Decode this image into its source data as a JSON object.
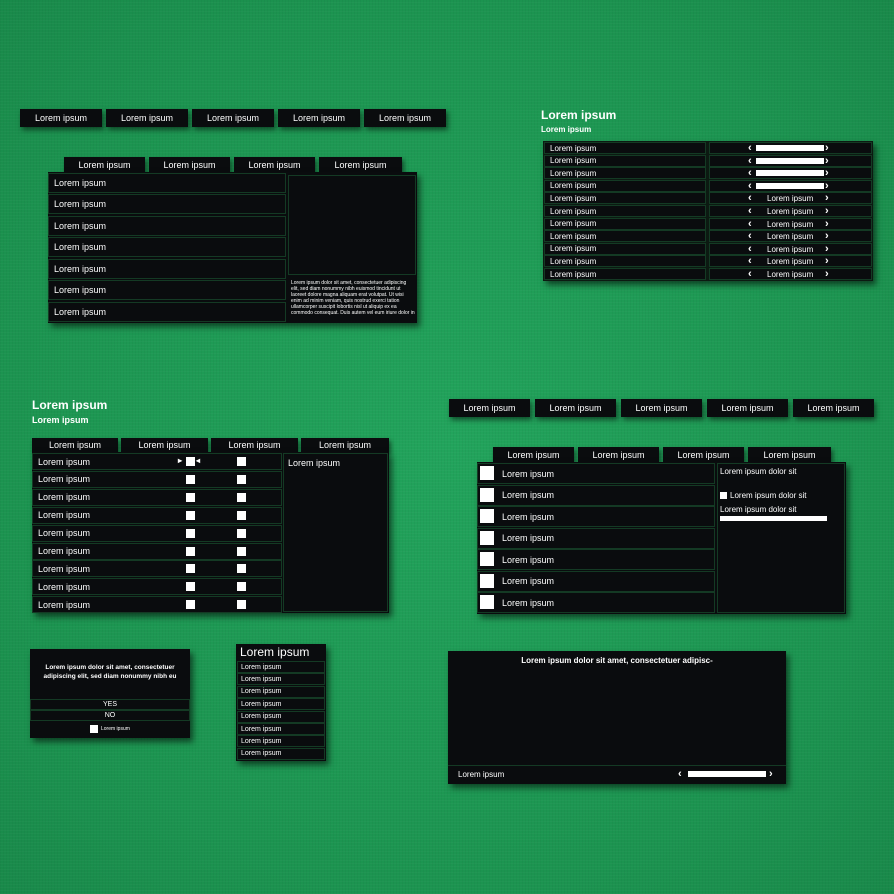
{
  "top_tabs_a": [
    "Lorem ipsum",
    "Lorem ipsum",
    "Lorem ipsum",
    "Lorem ipsum",
    "Lorem ipsum"
  ],
  "panel_a": {
    "tabs": [
      "Lorem ipsum",
      "Lorem ipsum",
      "Lorem ipsum",
      "Lorem ipsum"
    ],
    "rows": [
      "Lorem ipsum",
      "Lorem ipsum",
      "Lorem ipsum",
      "Lorem ipsum",
      "Lorem ipsum",
      "Lorem ipsum",
      "Lorem ipsum"
    ],
    "paragraph": "Lorem ipsum dolor sit amet, consectetuer adipiscing elit, sed diam nonummy nibh euismod tincidunt ut laoreet dolore magna aliquam erat volutpat. Ut wisi enim ad minim veniam, quis nostrud exerci tation ullamcorper suscipit lobortis nisl ut aliquip ex ea commodo consequat. Duis autem vel eum iriure dolor in"
  },
  "settings_panel": {
    "title": "Lorem ipsum",
    "subtitle": "Lorem ipsum",
    "rows": [
      {
        "label": "Lorem ipsum",
        "type": "slider",
        "value": 1.0
      },
      {
        "label": "Lorem ipsum",
        "type": "slider",
        "value": 1.0
      },
      {
        "label": "Lorem ipsum",
        "type": "slider",
        "value": 1.0
      },
      {
        "label": "Lorem ipsum",
        "type": "slider",
        "value": 1.0
      },
      {
        "label": "Lorem ipsum",
        "type": "select",
        "value": "Lorem ipsum"
      },
      {
        "label": "Lorem ipsum",
        "type": "select",
        "value": "Lorem ipsum"
      },
      {
        "label": "Lorem ipsum",
        "type": "select",
        "value": "Lorem ipsum"
      },
      {
        "label": "Lorem ipsum",
        "type": "select",
        "value": "Lorem ipsum"
      },
      {
        "label": "Lorem ipsum",
        "type": "select",
        "value": "Lorem ipsum"
      },
      {
        "label": "Lorem ipsum",
        "type": "select",
        "value": "Lorem ipsum"
      },
      {
        "label": "Lorem ipsum",
        "type": "select",
        "value": "Lorem ipsum"
      }
    ]
  },
  "checkbox_panel": {
    "title": "Lorem ipsum",
    "subtitle": "Lorem ipsum",
    "tabs": [
      "Lorem ipsum",
      "Lorem ipsum",
      "Lorem ipsum",
      "Lorem ipsum"
    ],
    "rows": [
      "Lorem ipsum",
      "Lorem ipsum",
      "Lorem ipsum",
      "Lorem ipsum",
      "Lorem ipsum",
      "Lorem ipsum",
      "Lorem ipsum",
      "Lorem ipsum",
      "Lorem ipsum"
    ],
    "side_label": "Lorem ipsum"
  },
  "top_tabs_b": [
    "Lorem ipsum",
    "Lorem ipsum",
    "Lorem ipsum",
    "Lorem ipsum",
    "Lorem ipsum"
  ],
  "panel_b": {
    "tabs": [
      "Lorem ipsum",
      "Lorem ipsum",
      "Lorem ipsum",
      "Lorem ipsum"
    ],
    "rows": [
      "Lorem ipsum",
      "Lorem ipsum",
      "Lorem ipsum",
      "Lorem ipsum",
      "Lorem ipsum",
      "Lorem ipsum",
      "Lorem ipsum"
    ],
    "side_line1": "Lorem ipsum dolor sit",
    "side_check_label": "Lorem ipsum dolor sit",
    "side_line3": "Lorem ipsum dolor sit"
  },
  "dialog": {
    "message": "Lorem ipsum dolor sit amet, consectetuer adipiscing elit, sed diam nonummy nibh eu",
    "yes": "YES",
    "no": "NO",
    "checkbox_label": "Lorem ipsum"
  },
  "menu_list": {
    "title": "Lorem ipsum",
    "items": [
      "Lorem ipsum",
      "Lorem ipsum",
      "Lorem ipsum",
      "Lorem ipsum",
      "Lorem ipsum",
      "Lorem ipsum",
      "Lorem ipsum",
      "Lorem ipsum"
    ]
  },
  "media_panel": {
    "header": "Lorem ipsum dolor sit amet, consectetuer adipisc-",
    "footer_label": "Lorem ipsum",
    "slider_value": 1.0
  },
  "colors": {
    "background": "#1e9a55",
    "panel": "#0a0c0e",
    "row_border": "#143a24"
  }
}
